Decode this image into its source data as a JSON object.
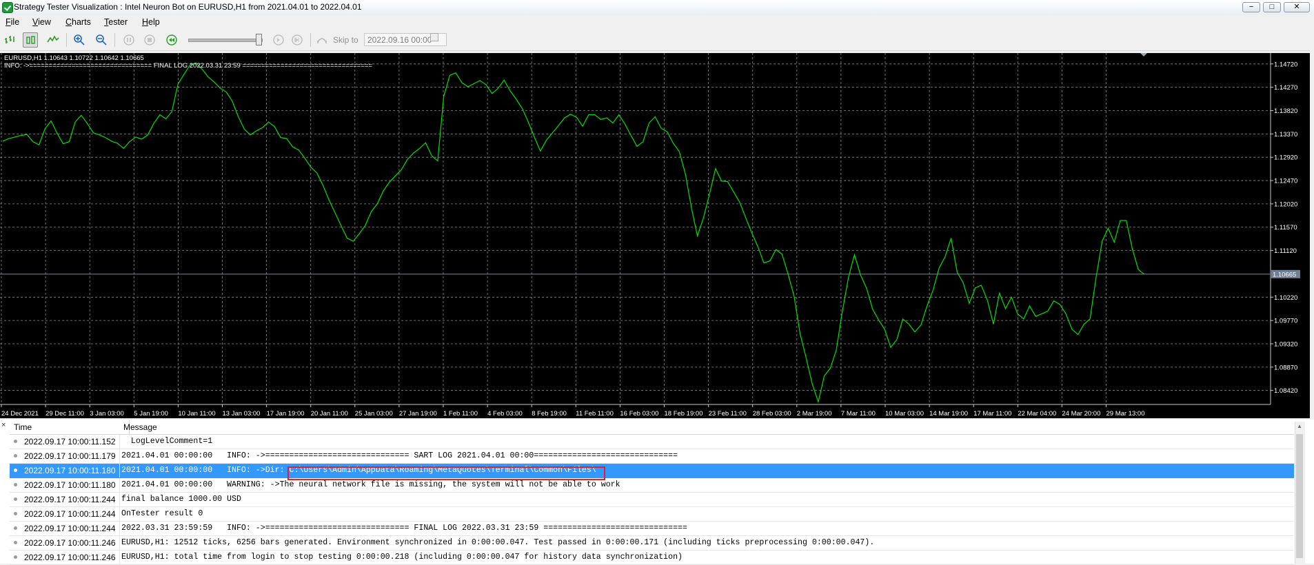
{
  "window": {
    "title": "Strategy Tester Visualization : Intel Neuron Bot on EURUSD,H1 from 2021.04.01 to 2022.04.01",
    "buttons": {
      "minimize": "−",
      "maximize": "□",
      "close": "✕"
    }
  },
  "menu": {
    "items": [
      {
        "label": "File",
        "key": "F",
        "rest": "ile"
      },
      {
        "label": "View",
        "key": "V",
        "rest": "iew"
      },
      {
        "label": "Charts",
        "key": "C",
        "rest": "harts"
      },
      {
        "label": "Tester",
        "key": "T",
        "rest": "ester"
      },
      {
        "label": "Help",
        "key": "H",
        "rest": "elp"
      }
    ]
  },
  "toolbar": {
    "icons": [
      "bar-chart-icon",
      "candlestick-icon",
      "line-chart-icon",
      "zoom-in-icon",
      "zoom-out-icon",
      "pause-icon",
      "stop-icon",
      "speed-back-icon",
      "step-forward-icon",
      "skip-end-icon",
      "skip-to-icon"
    ],
    "skip_to_label": "Skip to",
    "skip_to_date": "2022.09.16 00:00",
    "speed_level": 0.98
  },
  "chart_data": {
    "type": "line",
    "symbol_info": "EURUSD,H1  1.10643 1.10722 1.10642 1.10665",
    "info_line": "INFO: ->================================ FINAL LOG 2022.03.31 23:59 ==================================",
    "current_price": "1.10665",
    "y_ticks": [
      "1.14720",
      "1.14270",
      "1.13820",
      "1.13370",
      "1.12920",
      "1.12470",
      "1.12020",
      "1.11570",
      "1.11120",
      "1.10220",
      "1.09770",
      "1.09320",
      "1.08870",
      "1.08420"
    ],
    "x_ticks": [
      "24 Dec 2021",
      "29 Dec 11:00",
      "3 Jan 03:00",
      "5 Jan 19:00",
      "10 Jan 11:00",
      "13 Jan 03:00",
      "17 Jan 19:00",
      "20 Jan 11:00",
      "25 Jan 03:00",
      "27 Jan 19:00",
      "1 Feb 11:00",
      "4 Feb 03:00",
      "8 Feb 19:00",
      "11 Feb 11:00",
      "16 Feb 03:00",
      "18 Feb 19:00",
      "23 Feb 11:00",
      "28 Feb 03:00",
      "2 Mar 19:00",
      "7 Mar 11:00",
      "10 Mar 03:00",
      "14 Mar 19:00",
      "17 Mar 11:00",
      "22 Mar 04:00",
      "24 Mar 20:00",
      "29 Mar 13:00"
    ],
    "ylim": [
      1.0815,
      1.1493
    ],
    "series": [
      {
        "color": "#00e000",
        "values": [
          1.1323,
          1.1328,
          1.1331,
          1.1334,
          1.1336,
          1.1322,
          1.1316,
          1.1347,
          1.1362,
          1.1338,
          1.1318,
          1.1322,
          1.136,
          1.1373,
          1.1357,
          1.1339,
          1.1335,
          1.133,
          1.1323,
          1.1319,
          1.1309,
          1.1322,
          1.1331,
          1.1327,
          1.1335,
          1.1357,
          1.1374,
          1.1366,
          1.138,
          1.1433,
          1.1452,
          1.147,
          1.1474,
          1.1462,
          1.1447,
          1.1437,
          1.1425,
          1.1418,
          1.14,
          1.137,
          1.1346,
          1.1335,
          1.1343,
          1.1349,
          1.136,
          1.1351,
          1.133,
          1.1328,
          1.1312,
          1.1306,
          1.129,
          1.1273,
          1.1262,
          1.1238,
          1.121,
          1.1185,
          1.116,
          1.1136,
          1.113,
          1.1144,
          1.116,
          1.1187,
          1.1202,
          1.1227,
          1.1244,
          1.1256,
          1.1268,
          1.1288,
          1.13,
          1.1309,
          1.132,
          1.1295,
          1.1285,
          1.1409,
          1.145,
          1.1455,
          1.1436,
          1.1428,
          1.1434,
          1.144,
          1.1432,
          1.1415,
          1.1425,
          1.1441,
          1.142,
          1.1404,
          1.1386,
          1.136,
          1.1331,
          1.1304,
          1.1325,
          1.1339,
          1.1353,
          1.1368,
          1.1375,
          1.1369,
          1.1352,
          1.1374,
          1.1374,
          1.1365,
          1.1368,
          1.1358,
          1.1374,
          1.1356,
          1.1334,
          1.1313,
          1.1322,
          1.1358,
          1.137,
          1.1348,
          1.1341,
          1.1319,
          1.1303,
          1.126,
          1.1195,
          1.114,
          1.1175,
          1.1221,
          1.127,
          1.1246,
          1.1245,
          1.1225,
          1.1205,
          1.1175,
          1.1146,
          1.112,
          1.1088,
          1.1092,
          1.1114,
          1.1105,
          1.1067,
          1.1024,
          1.0951,
          1.0905,
          1.0855,
          1.082,
          1.087,
          1.0885,
          1.092,
          1.0995,
          1.106,
          1.1104,
          1.1065,
          1.1039,
          1.0999,
          1.0978,
          1.096,
          1.0925,
          1.094,
          1.098,
          1.097,
          1.0955,
          1.0968,
          1.1005,
          1.1035,
          1.1078,
          1.11,
          1.1136,
          1.107,
          1.105,
          1.101,
          1.104,
          1.1045,
          1.1016,
          1.097,
          1.103,
          1.1,
          1.1022,
          1.099,
          1.098,
          1.1005,
          1.0985,
          1.099,
          1.0995,
          1.1015,
          1.1008,
          1.099,
          1.096,
          1.095,
          1.097,
          1.098,
          1.106,
          1.113,
          1.1155,
          1.1128,
          1.117,
          1.117,
          1.1115,
          1.1075,
          1.1066
        ]
      }
    ]
  },
  "journal": {
    "close_glyph": "×",
    "columns": {
      "time": "Time",
      "message": "Message"
    },
    "rows": [
      {
        "time": "2022.09.17 10:00:11.152",
        "message": "  LogLevelComment=1"
      },
      {
        "time": "2022.09.17 10:00:11.179",
        "message": "2021.04.01 00:00:00   INFO: ->============================== SART LOG 2021.04.01 00:00=============================="
      },
      {
        "time": "2022.09.17 10:00:11.180",
        "message": "2021.04.01 00:00:00   INFO: ->Dir: C:\\Users\\Admin\\AppData\\Roaming\\MetaQuotes\\Terminal\\Common\\Files\\"
      },
      {
        "time": "2022.09.17 10:00:11.180",
        "message": "2021.04.01 00:00:00   WARNING: ->The neural network file is missing, the system will not be able to work"
      },
      {
        "time": "2022.09.17 10:00:11.244",
        "message": "final balance 1000.00 USD"
      },
      {
        "time": "2022.09.17 10:00:11.244",
        "message": "OnTester result 0"
      },
      {
        "time": "2022.09.17 10:00:11.244",
        "message": "2022.03.31 23:59:59   INFO: ->============================== FINAL LOG 2022.03.31 23:59 =============================="
      },
      {
        "time": "2022.09.17 10:00:11.246",
        "message": "EURUSD,H1: 12512 ticks, 6256 bars generated. Environment synchronized in 0:00:00.047. Test passed in 0:00:00.171 (including ticks preprocessing 0:00:00.047)."
      },
      {
        "time": "2022.09.17 10:00:11.246",
        "message": "EURUSD,H1: total time from login to stop testing 0:00:00.218 (including 0:00:00.047 for history data synchronization)"
      }
    ],
    "selected_row": 2
  }
}
